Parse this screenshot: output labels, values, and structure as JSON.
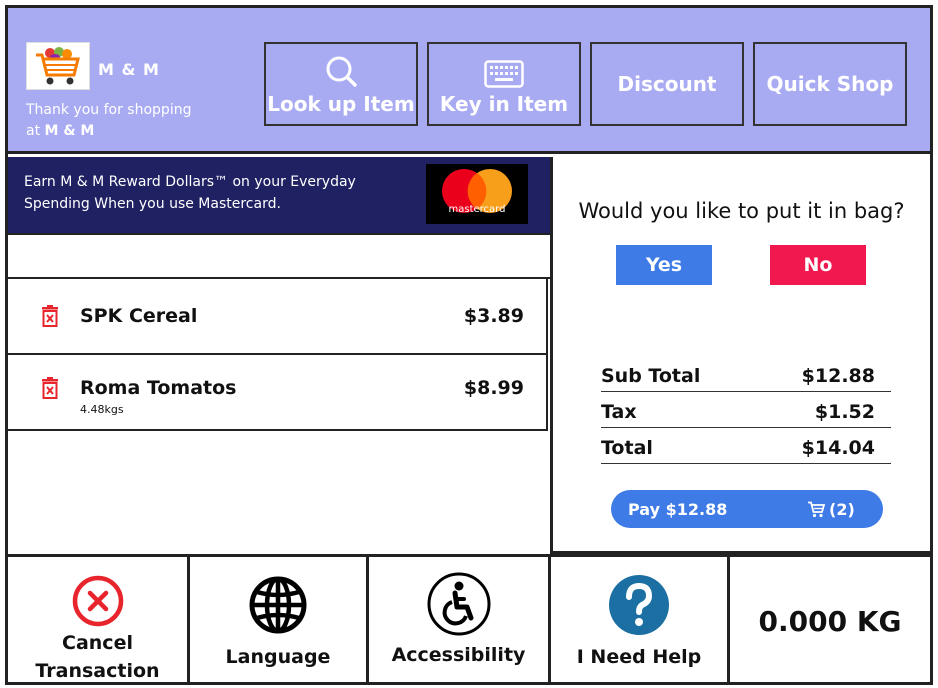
{
  "header": {
    "brand": "M & M",
    "thanks_line1": "Thank you for shopping",
    "thanks_at": "at",
    "thanks_brand": "M & M",
    "buttons": [
      {
        "label": "Look up Item",
        "icon": "search-icon"
      },
      {
        "label": "Key in Item",
        "icon": "keyboard-icon"
      },
      {
        "label": "Discount",
        "icon": null
      },
      {
        "label": "Quick Shop",
        "icon": null
      }
    ]
  },
  "promo": {
    "line1": "Earn  M & M Reward Dollars™ on your Everyday",
    "line2": "Spending When you use Mastercard.",
    "card_label": "mastercard"
  },
  "items": [
    {
      "name": "SPK Cereal",
      "sub": "",
      "price": "$3.89"
    },
    {
      "name": "Roma Tomatos",
      "sub": "4.48kgs",
      "price": "$8.99"
    }
  ],
  "bag_prompt": {
    "question": "Would you like to put it in bag?",
    "yes": "Yes",
    "no": "No"
  },
  "totals": {
    "subtotal_label": "Sub Total",
    "subtotal": "$12.88",
    "tax_label": "Tax",
    "tax": "$1.52",
    "total_label": "Total",
    "total": "$14.04"
  },
  "pay": {
    "label": "Pay $12.88",
    "cart_count": "(2)"
  },
  "bottom": {
    "cancel_line1": "Cancel",
    "cancel_line2": "Transaction",
    "language": "Language",
    "accessibility": "Accessibility",
    "help": "I Need Help",
    "weight": "0.000 KG"
  },
  "colors": {
    "header_bg": "#a9abf2",
    "promo_bg": "#1f2163",
    "yes": "#3e7be6",
    "no": "#f0184f",
    "pay": "#3e7be6",
    "cancel_red": "#e8242c",
    "help_blue": "#1c6fa3"
  }
}
